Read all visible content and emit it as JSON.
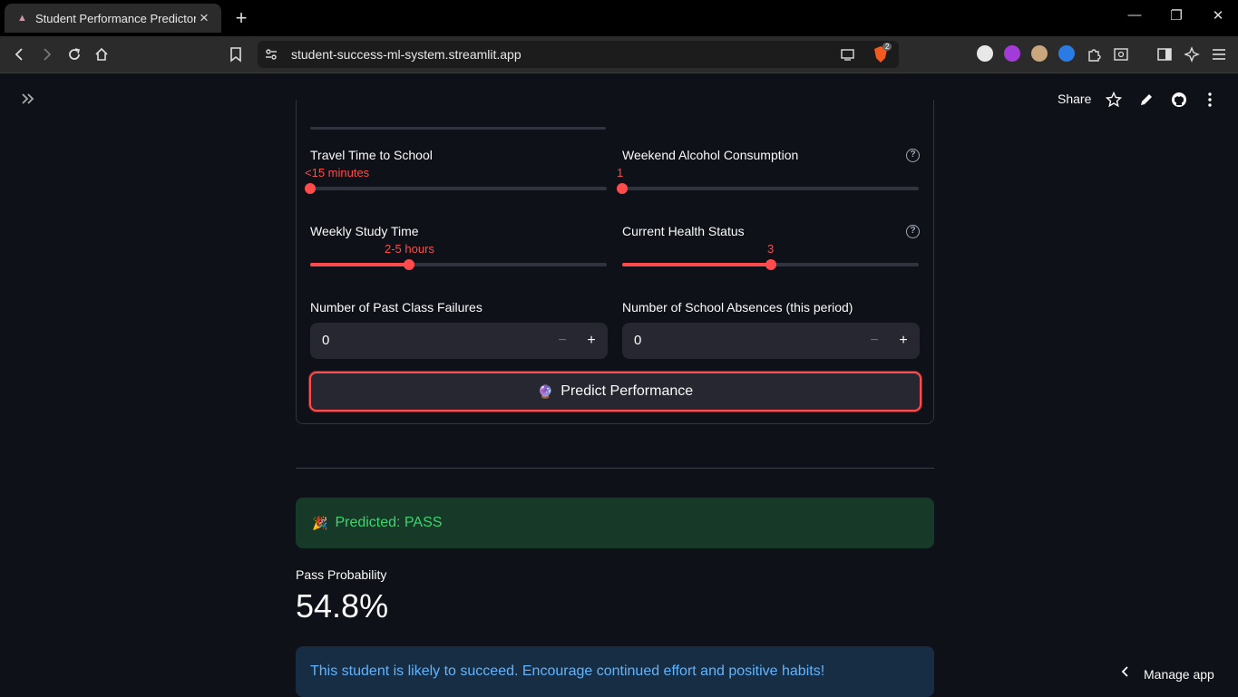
{
  "browser": {
    "tab_title": "Student Performance Predictor",
    "url": "student-success-ml-system.streamlit.app",
    "brave_badge": "2"
  },
  "app_header": {
    "share_label": "Share"
  },
  "form": {
    "travel_time": {
      "label": "Travel Time to School",
      "value": "<15 minutes",
      "level": 0
    },
    "alcohol": {
      "label": "Weekend Alcohol Consumption",
      "value": "1",
      "level": 0
    },
    "study_time": {
      "label": "Weekly Study Time",
      "value": "2-5 hours",
      "level": 0.333
    },
    "health": {
      "label": "Current Health Status",
      "value": "3",
      "level": 0.5
    },
    "failures": {
      "label": "Number of Past Class Failures",
      "value": "0",
      "minus": "−",
      "plus": "+"
    },
    "absences": {
      "label": "Number of School Absences (this period)",
      "value": "0",
      "minus": "−",
      "plus": "+"
    },
    "help_icon": "?",
    "predict_button": {
      "icon": "🔮",
      "label": "Predict Performance"
    }
  },
  "result": {
    "icon": "🎉",
    "prediction": "Predicted: PASS",
    "metric_label": "Pass Probability",
    "metric_value": "54.8%",
    "message": "This student is likely to succeed. Encourage continued effort and positive habits!"
  },
  "footer": {
    "manage_label": "Manage app"
  },
  "colors": {
    "accent": "#ff4b4b",
    "success_bg": "#173928",
    "success_text": "#3dd56d",
    "info_bg": "#172d43",
    "info_text": "#60b4ff"
  }
}
